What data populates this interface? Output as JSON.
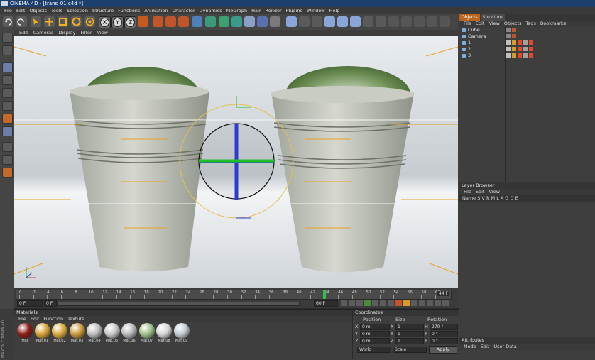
{
  "app": {
    "title": "CINEMA 4D - [trans_01.c4d *]",
    "menu": [
      "File",
      "Edit",
      "Objects",
      "Tools",
      "Selection",
      "Structure",
      "Functions",
      "Animation",
      "Character",
      "Dynamics",
      "MoGraph",
      "Hair",
      "Render",
      "Plugins",
      "Window",
      "Help"
    ]
  },
  "toolbar": {
    "axes": [
      "X",
      "Y",
      "Z"
    ]
  },
  "viewport": {
    "menu": [
      "Edit",
      "Cameras",
      "Display",
      "Filter",
      "View"
    ]
  },
  "timeline": {
    "ticks": [
      "0",
      "2",
      "4",
      "6",
      "8",
      "10",
      "12",
      "14",
      "16",
      "18",
      "20",
      "22",
      "24",
      "26",
      "28",
      "30",
      "32",
      "34",
      "36",
      "38",
      "40",
      "42",
      "44",
      "46",
      "48",
      "50",
      "52",
      "54",
      "56",
      "58",
      "60"
    ],
    "current_frame_label": "44 F",
    "current_frame": 44,
    "min_frame": 0,
    "max_frame": 60,
    "start_field": "0 F",
    "end_field": "60 F",
    "start_small": "0 F"
  },
  "materials": {
    "header": "Materials",
    "menu": [
      "File",
      "Edit",
      "Function",
      "Texture"
    ],
    "items": [
      {
        "name": "Mat",
        "color": "#8c1a12"
      },
      {
        "name": "Mat.01",
        "color": "#d7a238"
      },
      {
        "name": "Mat.02",
        "color": "#d9a83b"
      },
      {
        "name": "Mat.03",
        "color": "#c99738"
      },
      {
        "name": "Mat.04",
        "color": "#bdbdbd"
      },
      {
        "name": "Mat.05",
        "color": "#c8c8c8"
      },
      {
        "name": "Mat.06",
        "color": "#b9b9b9"
      },
      {
        "name": "Mat.07",
        "color": "#9fbf8a"
      },
      {
        "name": "Mat.08",
        "color": "#d6d6d6"
      },
      {
        "name": "Mat.09",
        "color": "#c1c9d0"
      }
    ],
    "brand": "MAXON CINEMA 4D"
  },
  "coordinates": {
    "header": "Coordinates",
    "col_position": "Position",
    "col_size": "Size",
    "col_rotation": "Rotation",
    "rows": [
      {
        "axis": "X",
        "pos": "0 m",
        "size": "1",
        "rot_label": "H",
        "rot": "270 °"
      },
      {
        "axis": "Y",
        "pos": "0 m",
        "size": "1",
        "rot_label": "P",
        "rot": "0 °"
      },
      {
        "axis": "Z",
        "pos": "0 m",
        "size": "1",
        "rot_label": "B",
        "rot": "0 °"
      }
    ],
    "mode_world": "World",
    "mode_scale": "Scale",
    "apply_label": "Apply"
  },
  "objects_panel": {
    "tabs": [
      "Objects",
      "Structure"
    ],
    "menu": [
      "File",
      "Edit",
      "View",
      "Objects",
      "Tags",
      "Bookmarks"
    ],
    "items": [
      {
        "name": "Cube"
      },
      {
        "name": "Camera"
      },
      {
        "name": "1"
      },
      {
        "name": "2"
      },
      {
        "name": "3"
      }
    ]
  },
  "layer_browser": {
    "header": "Layer Browser",
    "menu": [
      "File",
      "Edit",
      "View"
    ],
    "columns": "Name   S V R M L A G D E"
  },
  "attributes": {
    "header": "Attributes",
    "menu": [
      "Mode",
      "Edit",
      "User Data"
    ]
  },
  "colors": {
    "title_bar": "#1c3f6e",
    "accent_tab": "#b9651e",
    "axis_x": "#1fbf2a",
    "axis_y": "#2a3dcf",
    "guides": "#e8a020"
  }
}
